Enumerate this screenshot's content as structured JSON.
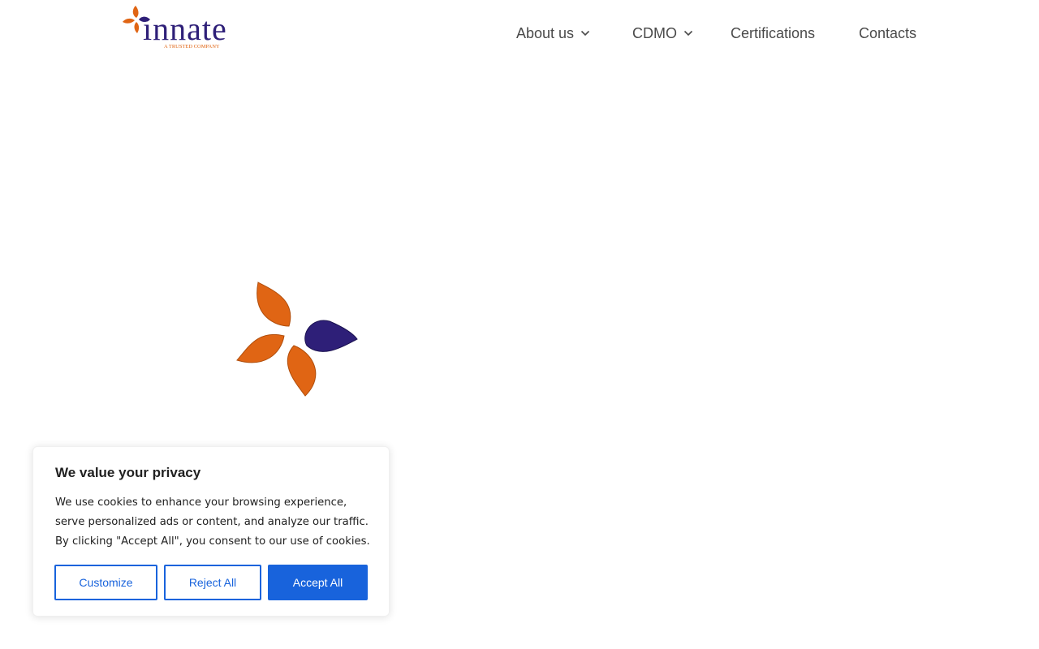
{
  "header": {
    "logo": {
      "name": "innate",
      "tagline": "A TRUSTED COMPANY",
      "colors": {
        "wordmark": "#2e1f78",
        "petal_orange": "#e06514",
        "petal_purple": "#2e1f78"
      }
    },
    "nav": [
      {
        "label": "About us",
        "has_dropdown": true
      },
      {
        "label": "CDMO",
        "has_dropdown": true
      },
      {
        "label": "Certifications",
        "has_dropdown": false
      },
      {
        "label": "Contacts",
        "has_dropdown": false
      }
    ]
  },
  "loader": {
    "icon": "flower-logo-icon",
    "colors": {
      "orange": "#e06514",
      "purple": "#2e1f78"
    }
  },
  "cookie_banner": {
    "title": "We value your privacy",
    "text": "We use cookies to enhance your browsing experience, serve personalized ads or content, and analyze our traffic. By clicking \"Accept All\", you consent to our use of cookies.",
    "buttons": {
      "customize": "Customize",
      "reject": "Reject All",
      "accept": "Accept All"
    },
    "accent_color": "#1863dc"
  }
}
